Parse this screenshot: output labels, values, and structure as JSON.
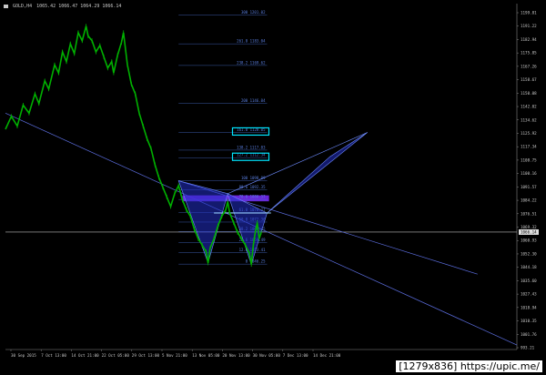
{
  "window": {
    "symbol": "GOLD,H4",
    "ohlc": "1065.42 1066.47 1064.29 1066.14"
  },
  "watermark": "[1279x836] https://upic.me/",
  "colors": {
    "background": "#000000",
    "candle": "#00b000",
    "fib": "#4a6fd0",
    "fib_text": "#5a7fe0",
    "axis_text": "#c8c8c8",
    "pattern_fill": "#2230c8",
    "highlight_band": "#7a2cff",
    "price_box": "#00e5ff"
  },
  "chart_data": {
    "type": "line",
    "title": "",
    "xlabel": "",
    "ylabel": "",
    "ylim": [
      993.21,
      1208.0
    ],
    "grid": false,
    "y_ticks": [
      "1199.81",
      "1191.22",
      "1182.94",
      "1175.85",
      "1167.26",
      "1158.67",
      "1150.08",
      "1142.02",
      "1134.62",
      "1125.92",
      "1117.34",
      "1108.75",
      "1100.16",
      "1091.57",
      "1084.22",
      "1076.51",
      "1069.32",
      "1060.93",
      "1052.30",
      "1044.18",
      "1035.60",
      "1027.43",
      "1018.94",
      "1010.35",
      "1001.76",
      "993.21"
    ],
    "x_ticks": [
      "30 Sep 2015",
      "7 Oct 13:00",
      "14 Oct 21:00",
      "22 Oct 05:00",
      "29 Oct 13:00",
      "5 Nov 21:00",
      "13 Nov 05:00",
      "20 Nov 13:00",
      "30 Nov 05:00",
      "7 Dec 13:00",
      "14 Dec 21:00"
    ],
    "current_price": "1066.14",
    "price": [
      [
        0,
        1130
      ],
      [
        3,
        1138
      ],
      [
        6,
        1132
      ],
      [
        9,
        1145
      ],
      [
        12,
        1140
      ],
      [
        15,
        1152
      ],
      [
        17,
        1146
      ],
      [
        20,
        1160
      ],
      [
        22,
        1155
      ],
      [
        25,
        1170
      ],
      [
        27,
        1165
      ],
      [
        29,
        1178
      ],
      [
        31,
        1172
      ],
      [
        33,
        1183
      ],
      [
        35,
        1177
      ],
      [
        37,
        1190
      ],
      [
        39,
        1185
      ],
      [
        41,
        1194
      ],
      [
        42,
        1188
      ],
      [
        44,
        1185
      ],
      [
        46,
        1178
      ],
      [
        48,
        1182
      ],
      [
        50,
        1175
      ],
      [
        52,
        1168
      ],
      [
        54,
        1172
      ],
      [
        55,
        1165
      ],
      [
        57,
        1176
      ],
      [
        59,
        1184
      ],
      [
        60,
        1190
      ],
      [
        61,
        1180
      ],
      [
        62,
        1170
      ],
      [
        64,
        1158
      ],
      [
        66,
        1152
      ],
      [
        68,
        1140
      ],
      [
        70,
        1132
      ],
      [
        72,
        1124
      ],
      [
        74,
        1118
      ],
      [
        76,
        1108
      ],
      [
        78,
        1100
      ],
      [
        80,
        1094
      ],
      [
        82,
        1088
      ],
      [
        84,
        1082
      ],
      [
        86,
        1090
      ],
      [
        88,
        1095
      ],
      [
        90,
        1086
      ],
      [
        92,
        1080
      ],
      [
        94,
        1076
      ],
      [
        96,
        1068
      ],
      [
        98,
        1062
      ],
      [
        100,
        1058
      ],
      [
        102,
        1054
      ],
      [
        103,
        1047
      ],
      [
        104,
        1056
      ],
      [
        106,
        1062
      ],
      [
        108,
        1070
      ],
      [
        110,
        1076
      ],
      [
        112,
        1080
      ],
      [
        113,
        1085
      ],
      [
        114,
        1078
      ],
      [
        116,
        1072
      ],
      [
        118,
        1066
      ],
      [
        120,
        1062
      ],
      [
        122,
        1058
      ],
      [
        124,
        1053
      ],
      [
        125,
        1046
      ],
      [
        126,
        1058
      ],
      [
        127,
        1066
      ],
      [
        128,
        1072
      ],
      [
        129,
        1062
      ],
      [
        130,
        1066
      ]
    ],
    "fibonacci": [
      {
        "label": "300",
        "value": "1201.02"
      },
      {
        "label": "261.8",
        "value": "1183.04"
      },
      {
        "label": "238.2",
        "value": "1169.62"
      },
      {
        "label": "200",
        "value": "1146.04"
      },
      {
        "label": "161.8",
        "value": "1128.05"
      },
      {
        "label": "138.2",
        "value": "1117.03"
      },
      {
        "label": "127.2",
        "value": "1112.34"
      },
      {
        "label": "100",
        "value": "1098.09"
      },
      {
        "label": "88.6",
        "value": "1092.35"
      },
      {
        "label": "78.6",
        "value": "1086.37"
      },
      {
        "label": "61.8",
        "value": "1078.27"
      },
      {
        "label": "50.0",
        "value": "1072.36"
      },
      {
        "label": "38.2",
        "value": "1066.45"
      },
      {
        "label": "23.6",
        "value": "1059.49"
      },
      {
        "label": "12.8",
        "value": "1053.41"
      },
      {
        "label": "0",
        "value": "1046.25"
      }
    ],
    "highlighted_levels": [
      "1128.05",
      "1112.34"
    ],
    "pattern": {
      "name": "harmonic",
      "points": [
        [
          88,
          1098
        ],
        [
          103,
          1047
        ],
        [
          113,
          1090
        ],
        [
          125,
          1046
        ],
        [
          133,
          1078
        ],
        [
          165,
          1113
        ],
        [
          184,
          1128
        ]
      ]
    },
    "trendlines": [
      {
        "from": [
          0,
          1140
        ],
        "to": [
          260,
          996
        ]
      },
      {
        "from": [
          88,
          1098
        ],
        "to": [
          240,
          1040
        ]
      }
    ]
  }
}
